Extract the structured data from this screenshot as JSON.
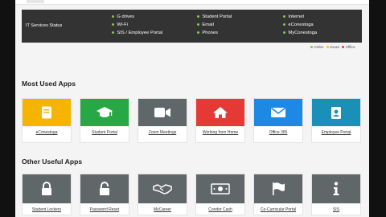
{
  "status_panel": {
    "title": "IT Services Status",
    "services": [
      {
        "label": "G drives",
        "status": "online"
      },
      {
        "label": "Wi-Fi",
        "status": "online"
      },
      {
        "label": "SIS / Employee Portal",
        "status": "online"
      },
      {
        "label": "Student Portal",
        "status": "online"
      },
      {
        "label": "Email",
        "status": "online"
      },
      {
        "label": "Phones",
        "status": "online"
      },
      {
        "label": "Internet",
        "status": "online"
      },
      {
        "label": "eConestoga",
        "status": "online"
      },
      {
        "label": "MyConestoga",
        "status": "online"
      }
    ],
    "legend": {
      "online": "Online",
      "issues": "Issues",
      "offline": "Offline"
    },
    "colors": {
      "online": "#8bc34a",
      "issues": "#ffc107",
      "offline": "#e53935"
    }
  },
  "most_used": {
    "title": "Most Used Apps",
    "apps": [
      {
        "label": "eConestoga",
        "icon": "book-icon",
        "color": "#f4b400"
      },
      {
        "label": "Student Portal",
        "icon": "graduation-cap-icon",
        "color": "#28a745"
      },
      {
        "label": "Zoom Meetings",
        "icon": "video-camera-icon",
        "color": "#5f6769"
      },
      {
        "label": "Working from Home",
        "icon": "home-icon",
        "color": "#e53935"
      },
      {
        "label": "Office 365",
        "icon": "envelope-icon",
        "color": "#1e88e5"
      },
      {
        "label": "Employee Portal",
        "icon": "id-badge-icon",
        "color": "#1a8fb8"
      }
    ]
  },
  "other_useful": {
    "title": "Other Useful Apps",
    "apps": [
      {
        "label": "Student Lockers",
        "icon": "lock-icon"
      },
      {
        "label": "Password Reset",
        "icon": "unlock-icon"
      },
      {
        "label": "MyCareer",
        "icon": "handshake-icon"
      },
      {
        "label": "Condor Cash",
        "icon": "money-icon"
      },
      {
        "label": "Co-Curricular Portal",
        "icon": "flag-icon"
      },
      {
        "label": "SIS",
        "icon": "info-icon"
      }
    ]
  }
}
